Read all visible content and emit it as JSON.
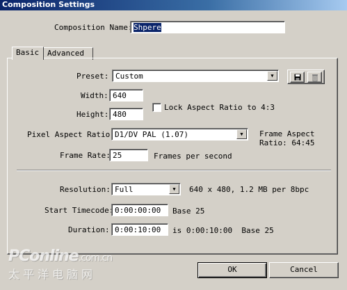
{
  "window": {
    "title": "Composition Settings"
  },
  "comp_name": {
    "label": "Composition Name:",
    "value": "Shpere"
  },
  "tabs": [
    {
      "label": "Basic"
    },
    {
      "label": "Advanced"
    }
  ],
  "preset": {
    "label": "Preset:",
    "value": "Custom",
    "save_icon": "floppy-disk-icon",
    "delete_icon": "trash-icon"
  },
  "width": {
    "label": "Width:",
    "value": "640"
  },
  "height": {
    "label": "Height:",
    "value": "480"
  },
  "lock_aspect": {
    "label": "Lock Aspect Ratio to 4:3",
    "checked": false
  },
  "pixel_aspect": {
    "label": "Pixel Aspect Ratio:",
    "value": "D1/DV PAL (1.07)",
    "frame_aspect_line1": "Frame Aspect",
    "frame_aspect_line2": "Ratio: 64:45"
  },
  "frame_rate": {
    "label": "Frame Rate:",
    "value": "25",
    "unit": "Frames per second"
  },
  "resolution": {
    "label": "Resolution:",
    "value": "Full",
    "info": "640 x 480, 1.2 MB per 8bpc"
  },
  "start_timecode": {
    "label": "Start Timecode:",
    "value": "0:00:00:00",
    "base": "Base 25"
  },
  "duration": {
    "label": "Duration:",
    "value": "0:00:10:00",
    "info": "is 0:00:10:00  Base 25"
  },
  "buttons": {
    "ok": "OK",
    "cancel": "Cancel"
  },
  "watermark": {
    "brand": "PConline",
    "domain": ".com.cn",
    "cn": "太平洋电脑网"
  }
}
